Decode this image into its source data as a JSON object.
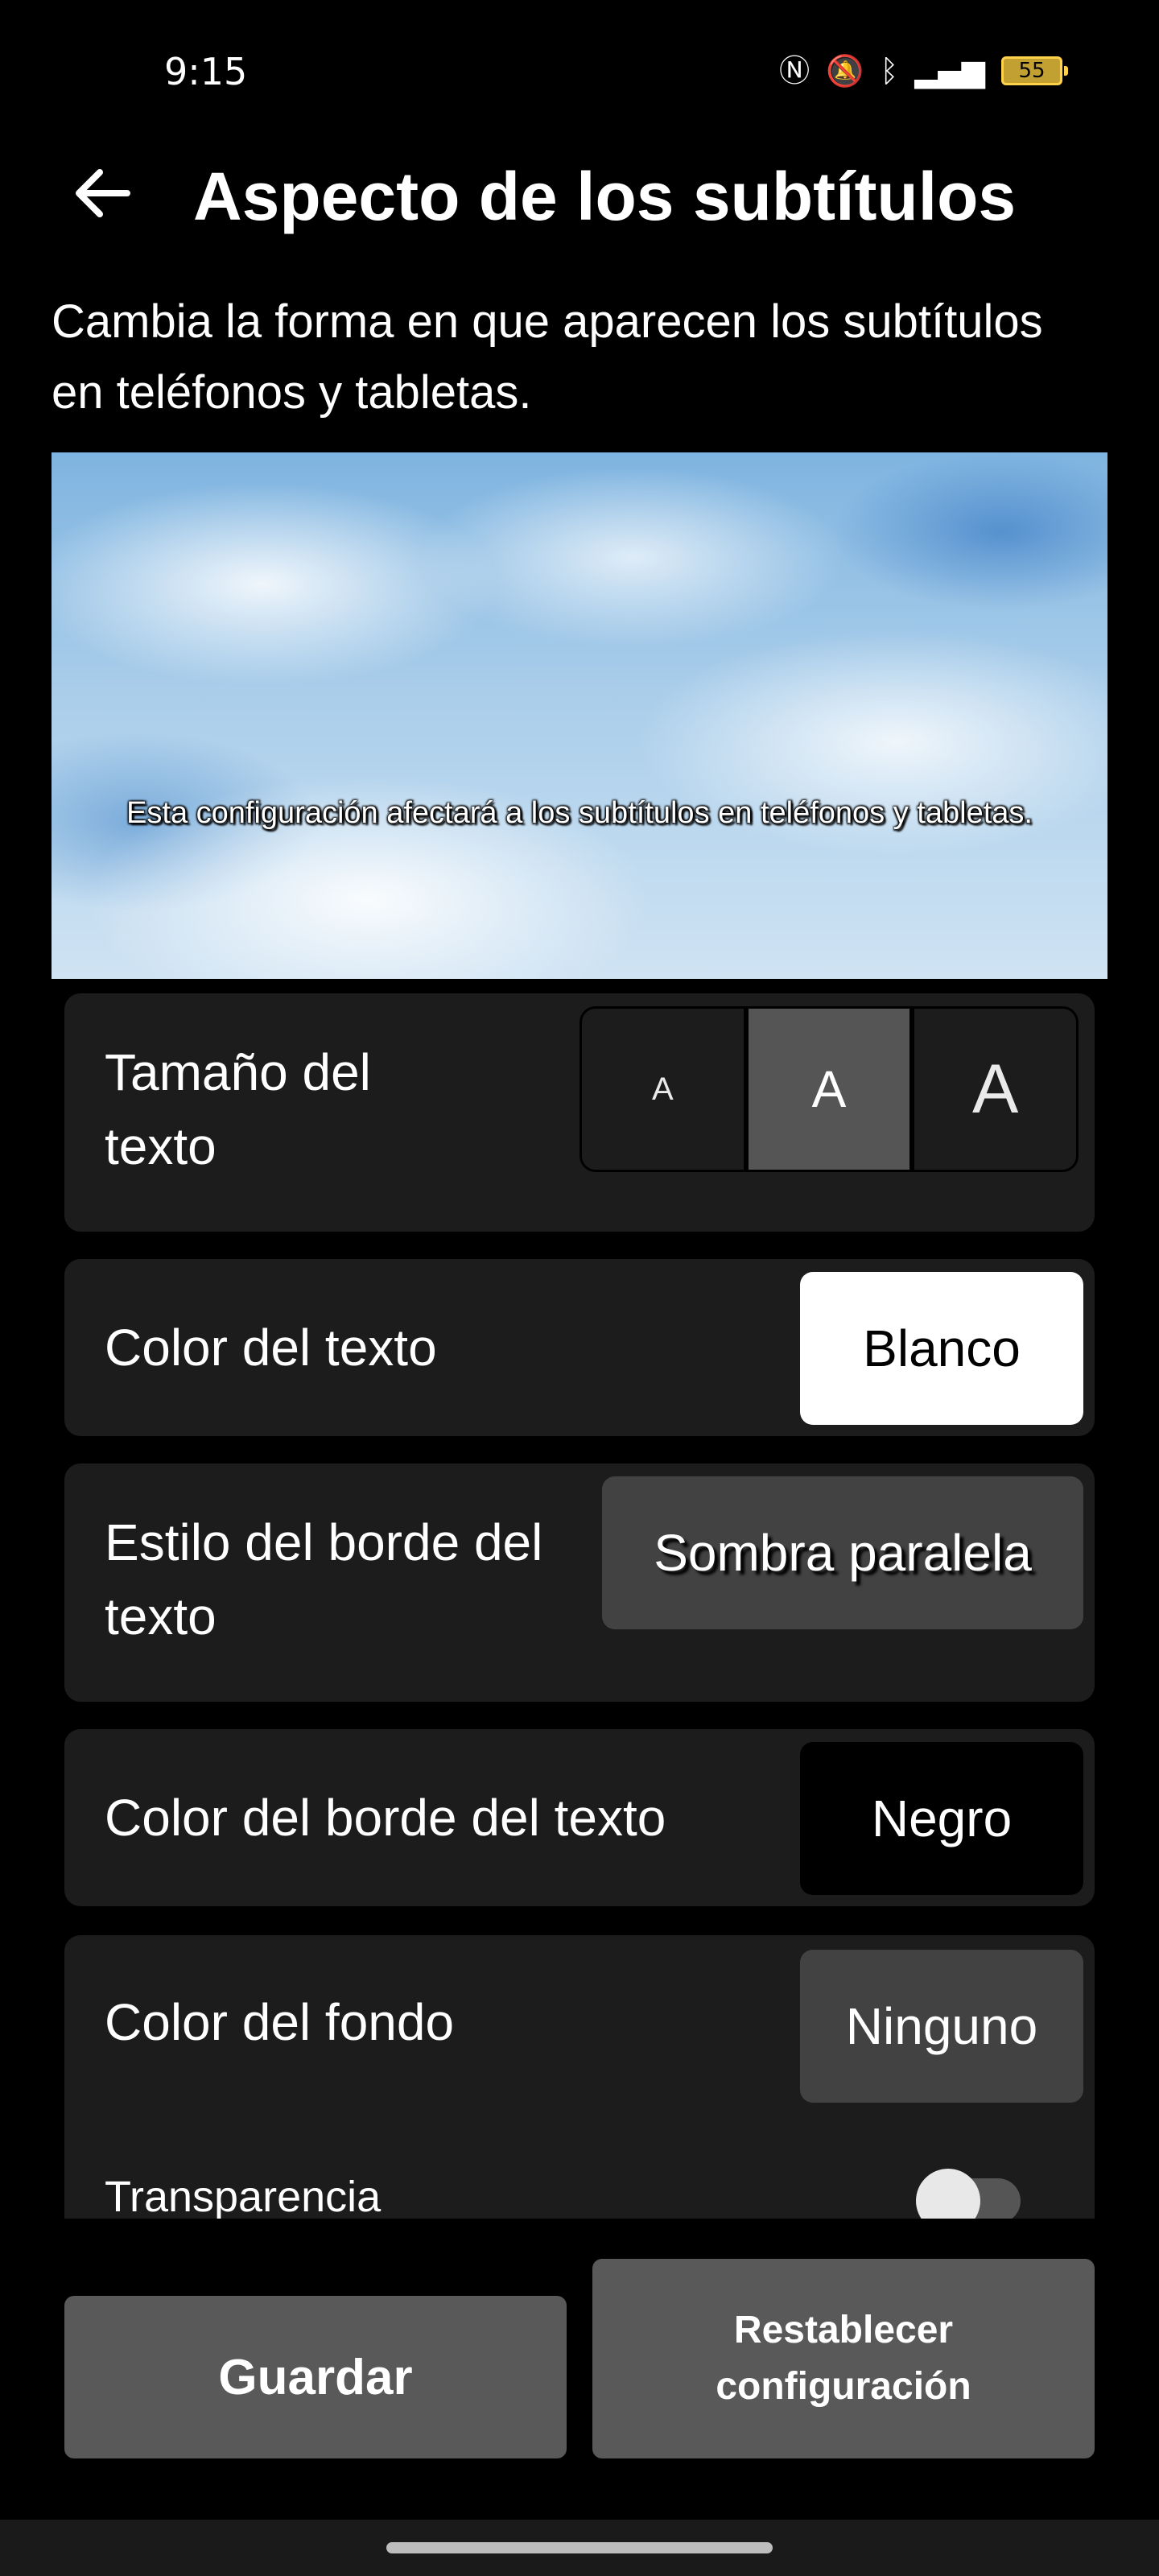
{
  "status_bar": {
    "time": "9:15",
    "icons": [
      "nfc-icon",
      "mute-icon",
      "bluetooth-icon",
      "signal-4g-icon"
    ],
    "battery": "55"
  },
  "header": {
    "title": "Aspecto de los subtítulos",
    "description": "Cambia la forma en que aparecen los subtítulos en teléfonos y tabletas."
  },
  "preview": {
    "caption": "Esta configuración afectará a los subtítulos en teléfonos y tabletas."
  },
  "settings": {
    "text_size": {
      "label": "Tamaño del texto",
      "options": [
        "A",
        "A",
        "A"
      ],
      "selected_index": 1
    },
    "text_color": {
      "label": "Color del texto",
      "value": "Blanco"
    },
    "edge_style": {
      "label": "Estilo del borde del texto",
      "value": "Sombra paralela"
    },
    "edge_color": {
      "label": "Color del borde del texto",
      "value": "Negro"
    },
    "background_color": {
      "label": "Color del fondo",
      "value": "Ninguno"
    },
    "transparency": {
      "label": "Transparencia",
      "enabled": false
    }
  },
  "actions": {
    "save": "Guardar",
    "reset": "Restablecer configuración"
  },
  "colors": {
    "background": "#000000",
    "card": "#1c1c1c",
    "button": "#595959",
    "selected": "#555555"
  }
}
